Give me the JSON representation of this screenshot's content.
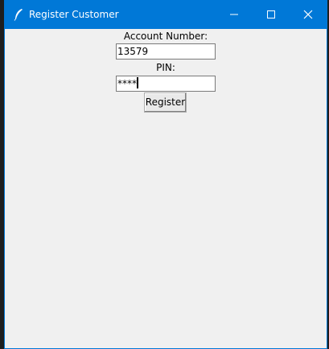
{
  "window": {
    "title": "Register Customer",
    "accent_color": "#0078d7",
    "background_color": "#f0f0f0",
    "icons": {
      "app": "feather-icon",
      "minimize": "minimize-icon",
      "maximize": "maximize-icon",
      "close": "close-icon"
    }
  },
  "form": {
    "account_label": "Account Number:",
    "account_value": "13579",
    "pin_label": "PIN:",
    "pin_value": "****",
    "register_label": "Register"
  }
}
